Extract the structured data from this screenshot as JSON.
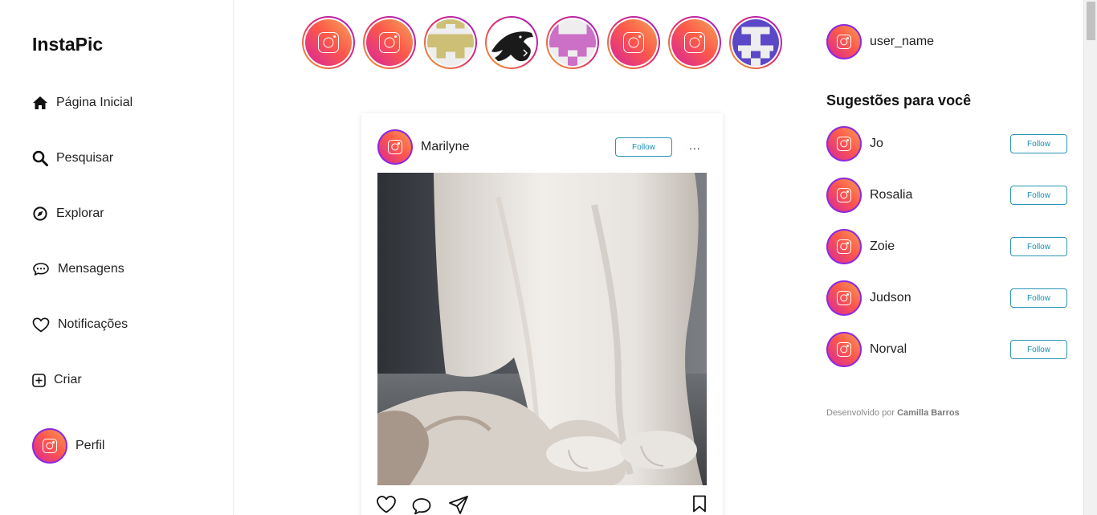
{
  "app": {
    "name": "InstaPic"
  },
  "nav": {
    "items": [
      {
        "label": "Página Inicial",
        "icon": "home-icon"
      },
      {
        "label": "Pesquisar",
        "icon": "search-icon"
      },
      {
        "label": "Explorar",
        "icon": "compass-icon"
      },
      {
        "label": "Mensagens",
        "icon": "message-icon"
      },
      {
        "label": "Notificações",
        "icon": "heart-icon"
      },
      {
        "label": "Criar",
        "icon": "plus-square-icon"
      },
      {
        "label": "Perfil",
        "icon": "avatar"
      }
    ]
  },
  "stories": [
    {
      "avatar": "instagram-logo"
    },
    {
      "avatar": "instagram-logo"
    },
    {
      "avatar": "pixel-identicon-olive"
    },
    {
      "avatar": "dinosaur-icon"
    },
    {
      "avatar": "pixel-identicon-pink"
    },
    {
      "avatar": "instagram-logo"
    },
    {
      "avatar": "instagram-logo"
    },
    {
      "avatar": "pixel-identicon-blue"
    }
  ],
  "post": {
    "author": "Marilyne",
    "follow_label": "Follow",
    "more_label": "...",
    "image": "white-cat-photo"
  },
  "current_user": {
    "username": "user_name"
  },
  "suggestions": {
    "title": "Sugestões para você",
    "follow_label": "Follow",
    "users": [
      {
        "name": "Jo"
      },
      {
        "name": "Rosalia"
      },
      {
        "name": "Zoie"
      },
      {
        "name": "Judson"
      },
      {
        "name": "Norval"
      }
    ]
  },
  "footer": {
    "prefix": "Desenvolvido por",
    "author": "Camilla Barros"
  },
  "colors": {
    "accent": "#2a95b5",
    "gradient_start": "#d6249f",
    "gradient_end": "#f2a45a"
  }
}
